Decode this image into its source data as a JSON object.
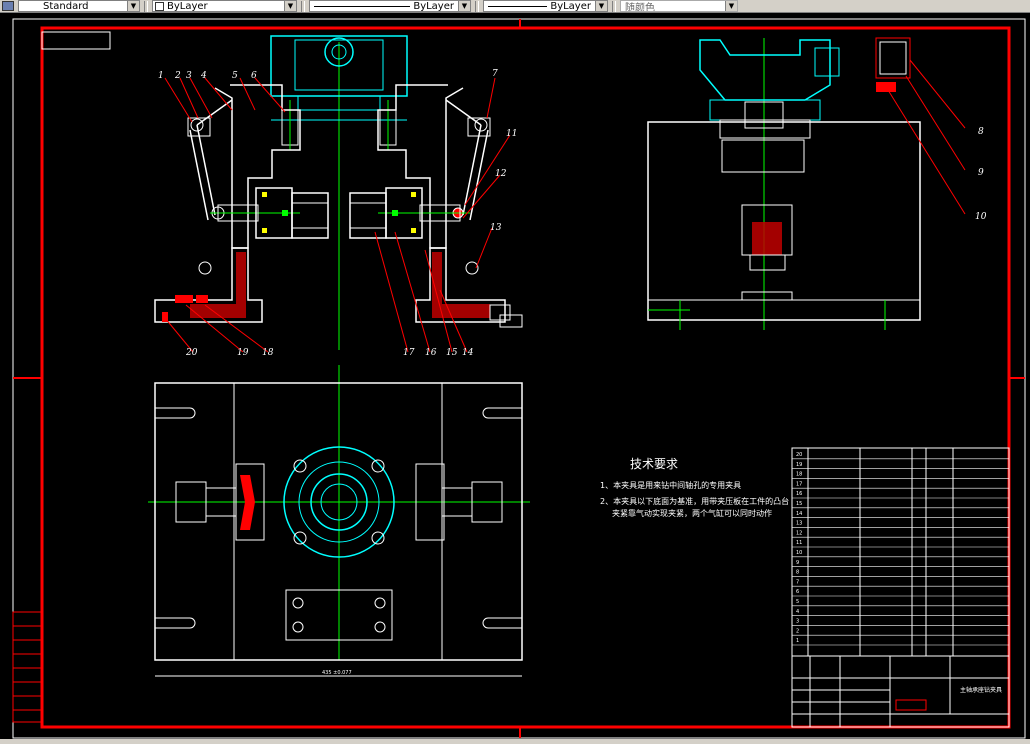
{
  "toolbar": {
    "text_style": "Standard",
    "layer": "ByLayer",
    "linetype": "ByLayer",
    "lineweight": "ByLayer",
    "color": "随颜色"
  },
  "drawing": {
    "tech_title": "技术要求",
    "tech_notes": [
      "1、本夹具是用来钻中间轴孔的专用夹具",
      "2、本夹具以下底面为基准，用带夹压板在工件的凸台",
      "夹紧靠气动实现夹紧，两个气缸可以同时动作"
    ],
    "callouts_front": [
      "1",
      "2",
      "3",
      "4",
      "5",
      "6",
      "7",
      "11",
      "12",
      "13",
      "14",
      "15",
      "16",
      "17",
      "18",
      "19",
      "20"
    ],
    "callouts_side": [
      "8",
      "9",
      "10"
    ],
    "dimension_text": "435 ±0.077",
    "title_block_name": "主轴承座钻夹具",
    "bom_numbers": [
      "20",
      "19",
      "18",
      "17",
      "16",
      "15",
      "14",
      "13",
      "12",
      "11",
      "10",
      "9",
      "8",
      "7",
      "6",
      "5",
      "4",
      "3",
      "2",
      "1"
    ]
  },
  "colors": {
    "border": "#ff0000",
    "outline": "#ffffff",
    "center": "#00ff00",
    "cyan": "#00ffff",
    "hatch": "#ff0000"
  }
}
